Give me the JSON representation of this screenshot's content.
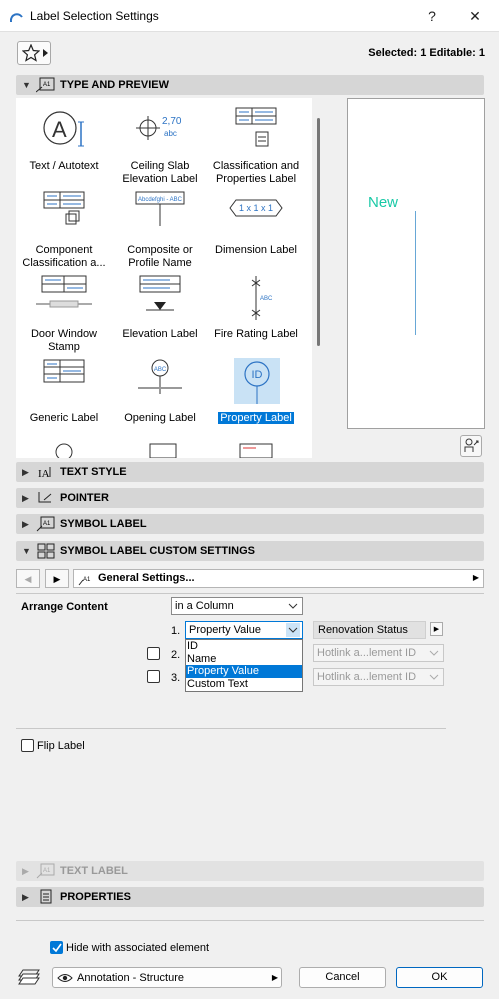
{
  "window": {
    "title": "Label Selection Settings",
    "help_label": "?",
    "close_label": "✕"
  },
  "header": {
    "selected_info": "Selected: 1 Editable: 1"
  },
  "sections": {
    "type_preview": "TYPE AND PREVIEW",
    "text_style": "TEXT STYLE",
    "pointer": "POINTER",
    "symbol_label": "SYMBOL LABEL",
    "symbol_custom": "SYMBOL LABEL CUSTOM SETTINGS",
    "text_label": "TEXT LABEL",
    "properties": "PROPERTIES"
  },
  "label_types": [
    {
      "label": "Text / Autotext",
      "icon": "text-autotext-icon"
    },
    {
      "label": "Ceiling Slab Elevation Label",
      "icon": "ceiling-slab-elevation-icon",
      "icon_text": "2,70"
    },
    {
      "label": "Classification and Properties Label",
      "icon": "classification-properties-icon"
    },
    {
      "label": "Component Classification a...",
      "icon": "component-classification-icon"
    },
    {
      "label": "Composite or Profile Name",
      "icon": "composite-profile-icon",
      "icon_text": "Abcdefghi - ABC"
    },
    {
      "label": "Dimension Label",
      "icon": "dimension-label-icon",
      "icon_text": "1 x 1 x 1"
    },
    {
      "label": "Door Window Stamp",
      "icon": "door-window-stamp-icon"
    },
    {
      "label": "Elevation Label",
      "icon": "elevation-label-icon"
    },
    {
      "label": "Fire Rating Label",
      "icon": "fire-rating-label-icon",
      "icon_text": "ABC"
    },
    {
      "label": "Generic Label",
      "icon": "generic-label-icon"
    },
    {
      "label": "Opening Label",
      "icon": "opening-label-icon",
      "icon_text": "ABC"
    },
    {
      "label": "Property Label",
      "icon": "property-label-icon",
      "icon_text": "ID",
      "selected": true
    }
  ],
  "preview": {
    "text": "New"
  },
  "custom_settings": {
    "panel_name": "General Settings...",
    "arrange_label": "Arrange Content",
    "arrange_value": "in a Column",
    "rows": [
      {
        "num": "1.",
        "value": "Property Value",
        "param": "Renovation Status"
      },
      {
        "num": "2.",
        "value": "",
        "param": "Hotlink a...lement ID"
      },
      {
        "num": "3.",
        "value": "",
        "param": "Hotlink a...lement ID"
      }
    ],
    "dropdown_options": [
      "ID",
      "Name",
      "Property Value",
      "Custom Text"
    ],
    "dropdown_selected": "Property Value",
    "flip_label": "Flip Label"
  },
  "footer": {
    "hide_label": "Hide with associated element",
    "layer": "Annotation - Structure",
    "cancel": "Cancel",
    "ok": "OK"
  },
  "colors": {
    "accent": "#0078d7",
    "preview_text": "#19c9a6",
    "icon_blue": "#2c73c4"
  }
}
